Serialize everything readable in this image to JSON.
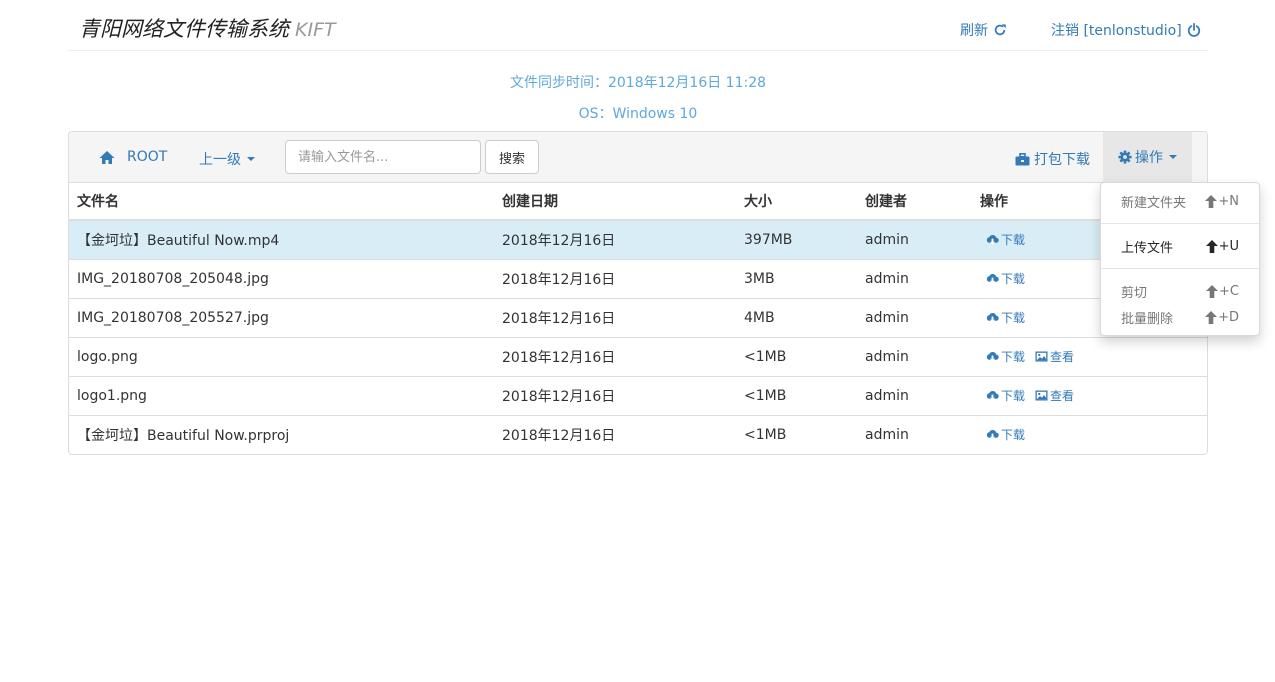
{
  "header": {
    "title": "青阳网络文件传输系统",
    "subtitle": "KIFT",
    "refresh_label": "刷新",
    "logout_label": "注销 [tenlonstudio]"
  },
  "info": {
    "sync_time": "文件同步时间：2018年12月16日 11:28",
    "os": "OS：Windows 10"
  },
  "toolbar": {
    "root_label": "ROOT",
    "up_label": "上一级",
    "search_placeholder": "请输入文件名...",
    "search_button": "搜索",
    "pack_download": "打包下载",
    "operations": "操作"
  },
  "table": {
    "headers": [
      "文件名",
      "创建日期",
      "大小",
      "创建者",
      "操作"
    ],
    "rows": [
      {
        "name": "【金坷垃】Beautiful Now.mp4",
        "date": "2018年12月16日",
        "size": "397MB",
        "creator": "admin",
        "selected": true,
        "has_view": false
      },
      {
        "name": "IMG_20180708_205048.jpg",
        "date": "2018年12月16日",
        "size": "3MB",
        "creator": "admin",
        "selected": false,
        "has_view": false
      },
      {
        "name": "IMG_20180708_205527.jpg",
        "date": "2018年12月16日",
        "size": "4MB",
        "creator": "admin",
        "selected": false,
        "has_view": false
      },
      {
        "name": "logo.png",
        "date": "2018年12月16日",
        "size": "<1MB",
        "creator": "admin",
        "selected": false,
        "has_view": true
      },
      {
        "name": "logo1.png",
        "date": "2018年12月16日",
        "size": "<1MB",
        "creator": "admin",
        "selected": false,
        "has_view": true
      },
      {
        "name": "【金坷垃】Beautiful Now.prproj",
        "date": "2018年12月16日",
        "size": "<1MB",
        "creator": "admin",
        "selected": false,
        "has_view": false
      }
    ],
    "download_label": "下载",
    "view_label": "查看"
  },
  "dropdown": {
    "new_folder": "新建文件夹",
    "new_folder_key": "+N",
    "upload": "上传文件",
    "upload_key": "+U",
    "cut": "剪切",
    "cut_key": "+C",
    "batch_delete": "批量删除",
    "batch_delete_key": "+D"
  },
  "colors": {
    "link": "#337ab7",
    "info_text": "#5fa8dc",
    "selected_row": "#d9edf7",
    "navbar_bg": "#f5f5f5"
  }
}
